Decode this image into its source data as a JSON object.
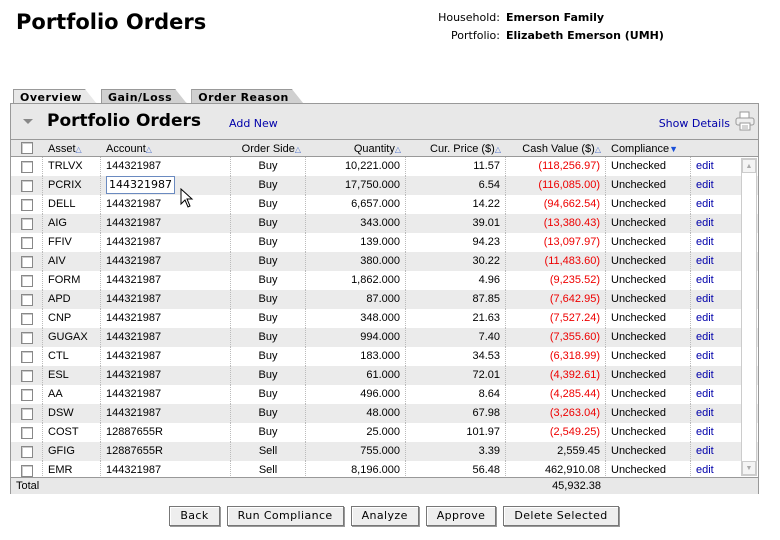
{
  "page": {
    "title": "Portfolio Orders"
  },
  "household": {
    "household_label": "Household:",
    "household_value": "Emerson Family",
    "portfolio_label": "Portfolio:",
    "portfolio_value": "Elizabeth Emerson (UMH)"
  },
  "tabs": [
    {
      "label": "Overview",
      "active": true
    },
    {
      "label": "Gain/Loss"
    },
    {
      "label": "Order Reason"
    }
  ],
  "panel": {
    "title": "Portfolio Orders",
    "add_new": "Add New",
    "show_details": "Show Details"
  },
  "columns": [
    "Asset",
    "Account",
    "Order Side",
    "Quantity",
    "Cur. Price ($)",
    "Cash Value ($)",
    "Compliance"
  ],
  "rows": [
    [
      "TRLVX",
      "144321987",
      "Buy",
      "10,221.000",
      "11.57",
      "(118,256.97)",
      "Unchecked",
      "edit"
    ],
    [
      "PCRIX",
      "144321987",
      "Buy",
      "17,750.000",
      "6.54",
      "(116,085.00)",
      "Unchecked",
      "edit"
    ],
    [
      "DELL",
      "144321987",
      "Buy",
      "6,657.000",
      "14.22",
      "(94,662.54)",
      "Unchecked",
      "edit"
    ],
    [
      "AIG",
      "144321987",
      "Buy",
      "343.000",
      "39.01",
      "(13,380.43)",
      "Unchecked",
      "edit"
    ],
    [
      "FFIV",
      "144321987",
      "Buy",
      "139.000",
      "94.23",
      "(13,097.97)",
      "Unchecked",
      "edit"
    ],
    [
      "AIV",
      "144321987",
      "Buy",
      "380.000",
      "30.22",
      "(11,483.60)",
      "Unchecked",
      "edit"
    ],
    [
      "FORM",
      "144321987",
      "Buy",
      "1,862.000",
      "4.96",
      "(9,235.52)",
      "Unchecked",
      "edit"
    ],
    [
      "APD",
      "144321987",
      "Buy",
      "87.000",
      "87.85",
      "(7,642.95)",
      "Unchecked",
      "edit"
    ],
    [
      "CNP",
      "144321987",
      "Buy",
      "348.000",
      "21.63",
      "(7,527.24)",
      "Unchecked",
      "edit"
    ],
    [
      "GUGAX",
      "144321987",
      "Buy",
      "994.000",
      "7.40",
      "(7,355.60)",
      "Unchecked",
      "edit"
    ],
    [
      "CTL",
      "144321987",
      "Buy",
      "183.000",
      "34.53",
      "(6,318.99)",
      "Unchecked",
      "edit"
    ],
    [
      "ESL",
      "144321987",
      "Buy",
      "61.000",
      "72.01",
      "(4,392.61)",
      "Unchecked",
      "edit"
    ],
    [
      "AA",
      "144321987",
      "Buy",
      "496.000",
      "8.64",
      "(4,285.44)",
      "Unchecked",
      "edit"
    ],
    [
      "DSW",
      "144321987",
      "Buy",
      "48.000",
      "67.98",
      "(3,263.04)",
      "Unchecked",
      "edit"
    ],
    [
      "COST",
      "12887655R",
      "Buy",
      "25.000",
      "101.97",
      "(2,549.25)",
      "Unchecked",
      "edit"
    ],
    [
      "GFIG",
      "12887655R",
      "Sell",
      "755.000",
      "3.39",
      "2,559.45",
      "Unchecked",
      "edit"
    ],
    [
      "EMR",
      "144321987",
      "Sell",
      "8,196.000",
      "56.48",
      "462,910.08",
      "Unchecked",
      "edit"
    ]
  ],
  "total": {
    "label": "Total",
    "cash_value": "45,932.38"
  },
  "buttons": {
    "back": "Back",
    "run_compliance": "Run Compliance",
    "analyze": "Analyze",
    "approve": "Approve",
    "delete_selected": "Delete Selected"
  },
  "colors": {
    "negative": "#e00000",
    "link": "#0000aa",
    "sort_active": "#1a4fd8"
  },
  "editing_cell": {
    "row": 1,
    "column": "Account"
  }
}
